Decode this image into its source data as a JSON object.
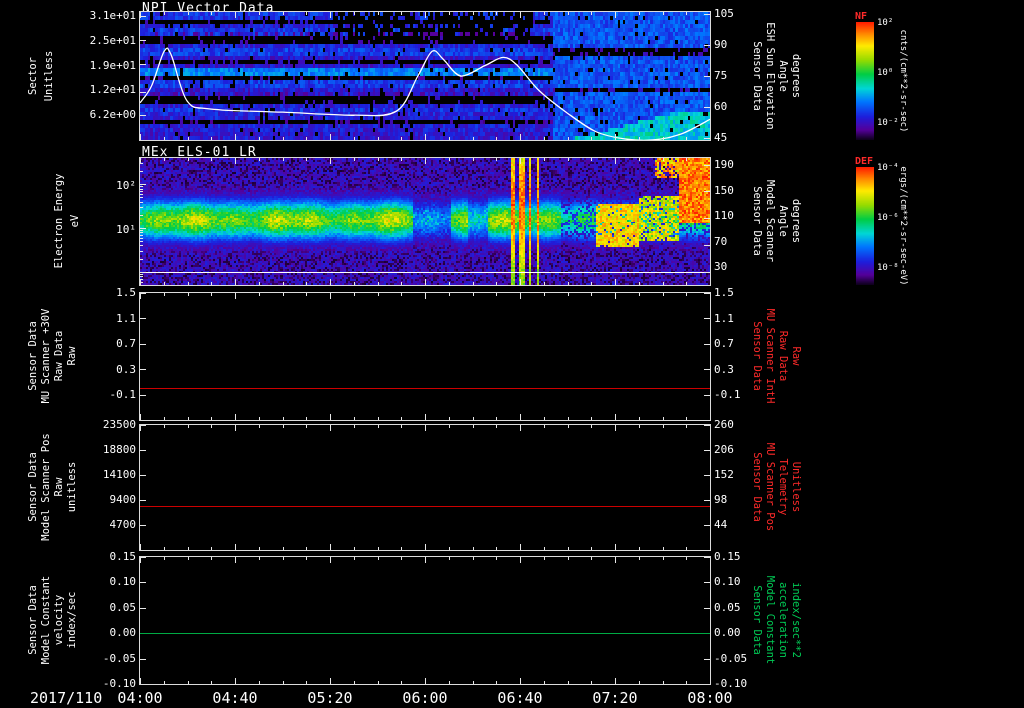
{
  "figure": {
    "bg": "#000000",
    "date_label": "2017/110",
    "x_tick_labels": [
      "04:00",
      "04:40",
      "05:20",
      "06:00",
      "06:40",
      "07:20",
      "08:00"
    ],
    "accent_red": "#ff2a2a",
    "accent_green": "#00cc55"
  },
  "colorbars": [
    {
      "label": "NF",
      "units": "cnts/(cm**2-sr-sec)",
      "ticks": [
        "10²",
        "10⁰",
        "10⁻²"
      ]
    },
    {
      "label": "DEF",
      "units": "ergs/(cm**2-sr-sec-eV)",
      "ticks": [
        "10⁻⁴",
        "10⁻⁶",
        "10⁻⁸"
      ]
    }
  ],
  "chart_data": [
    {
      "type": "heatmap",
      "title": "NPI Vector Data",
      "left_label_lines": [
        "Sector",
        "Unitless"
      ],
      "left_ticks": [
        "3.1e+01",
        "2.5e+01",
        "1.9e+01",
        "1.2e+01",
        "6.2e+00"
      ],
      "left_ticks_num": [
        31,
        25,
        19,
        12,
        6.2
      ],
      "left_range": [
        32,
        0
      ],
      "right_label_lines": [
        "Sensor Data",
        "ESH Sun Elevation",
        "Angle",
        "degrees"
      ],
      "right_ticks": [
        "105",
        "90",
        "75",
        "60",
        "45"
      ],
      "right_range": [
        106,
        44
      ],
      "x_range_hours": [
        4,
        8
      ],
      "palette": "rainbow",
      "description": "Low blue/purple count-rate spectrogram with black sector gaps; striped blue region with bright cyan lower-right wedge after 07:10",
      "overlay_line": {
        "name": "ESH Sun Elevation Angle",
        "color": "#ffffff",
        "axis_range": [
          106,
          44
        ],
        "points_hours_degrees": [
          [
            4.0,
            62
          ],
          [
            4.08,
            70
          ],
          [
            4.17,
            87
          ],
          [
            4.22,
            85
          ],
          [
            4.33,
            63
          ],
          [
            4.5,
            59
          ],
          [
            5.0,
            57.5
          ],
          [
            5.5,
            56
          ],
          [
            5.8,
            58
          ],
          [
            5.95,
            75
          ],
          [
            6.05,
            87
          ],
          [
            6.13,
            83
          ],
          [
            6.25,
            75
          ],
          [
            6.42,
            80
          ],
          [
            6.55,
            84
          ],
          [
            6.65,
            80
          ],
          [
            6.8,
            68
          ],
          [
            7.0,
            57
          ],
          [
            7.2,
            48
          ],
          [
            7.4,
            44.5
          ],
          [
            7.6,
            44
          ],
          [
            7.8,
            47
          ],
          [
            8.0,
            54
          ]
        ]
      }
    },
    {
      "type": "heatmap",
      "title": "MEx ELS-01 LR",
      "left_label_lines": [
        "Electron Energy",
        "eV"
      ],
      "left_ticks": [
        "10²",
        "10¹"
      ],
      "left_log_range": [
        2.6,
        -0.3
      ],
      "right_label_lines": [
        "Sensor Data",
        "Model Scanner",
        "Angle",
        "degrees"
      ],
      "right_ticks": [
        "190",
        "150",
        "110",
        "70",
        "30"
      ],
      "right_range": [
        200,
        10
      ],
      "x_range_hours": [
        4,
        8
      ],
      "palette": "rainbow",
      "description": "Bright green-yellow electron flux band ~7-60 eV across the interval; fades near 06:00 and 06:20; bright vertical streaks near 06:40; orange patches 07:15-07:45; intense red blob at high energy after 07:45; white marker line near 1 eV",
      "white_marker_line_logE": 0.0
    },
    {
      "type": "line",
      "left_label_lines": [
        "Sensor Data",
        "MU Scanner +30V",
        "Raw Data",
        "Raw"
      ],
      "left_ticks": [
        "1.5",
        "1.1",
        "0.7",
        "0.3",
        "-0.1"
      ],
      "left_ticks_num": [
        1.5,
        1.1,
        0.7,
        0.3,
        -0.1
      ],
      "y_range": [
        1.5,
        -0.5
      ],
      "right_label_lines": [
        "Sensor Data",
        "MU Scanner IntH",
        "Raw Data",
        "Raw"
      ],
      "right_ticks": [
        "1.5",
        "1.1",
        "0.7",
        "0.3",
        "-0.1"
      ],
      "series": [
        {
          "name": "MU Scanner +30V Raw Data",
          "value": 0.0,
          "color": "#cc0000"
        }
      ]
    },
    {
      "type": "line",
      "left_label_lines": [
        "Sensor Data",
        "Model Scanner Pos",
        "Raw",
        "unitless"
      ],
      "left_ticks": [
        "23500",
        "18800",
        "14100",
        "9400",
        "4700"
      ],
      "left_ticks_num": [
        23500,
        18800,
        14100,
        9400,
        4700
      ],
      "y_range": [
        23500,
        0
      ],
      "right_label_lines": [
        "Sensor Data",
        "MU Scanner Pos",
        "Telemetry",
        "Unitless"
      ],
      "right_ticks": [
        "260",
        "206",
        "152",
        "98",
        "44"
      ],
      "series": [
        {
          "name": "Model Scanner Pos Raw",
          "value": 8200,
          "color": "#cc0000"
        }
      ]
    },
    {
      "type": "line",
      "left_label_lines": [
        "Sensor Data",
        "Model Constant",
        "velocity",
        "index/sec"
      ],
      "left_ticks": [
        "0.15",
        "0.10",
        "0.05",
        "0.00",
        "-0.05",
        "-0.10"
      ],
      "left_ticks_num": [
        0.15,
        0.1,
        0.05,
        0.0,
        -0.05,
        -0.1
      ],
      "y_range": [
        0.15,
        -0.1
      ],
      "right_label_lines": [
        "Sensor Data",
        "Model Constant",
        "acceleration",
        "index/sec**2"
      ],
      "right_ticks": [
        "0.15",
        "0.10",
        "0.05",
        "0.00",
        "-0.05",
        "-0.10"
      ],
      "series": [
        {
          "name": "Model Constant velocity",
          "value": 0.0,
          "color": "#00aa44"
        }
      ]
    }
  ]
}
